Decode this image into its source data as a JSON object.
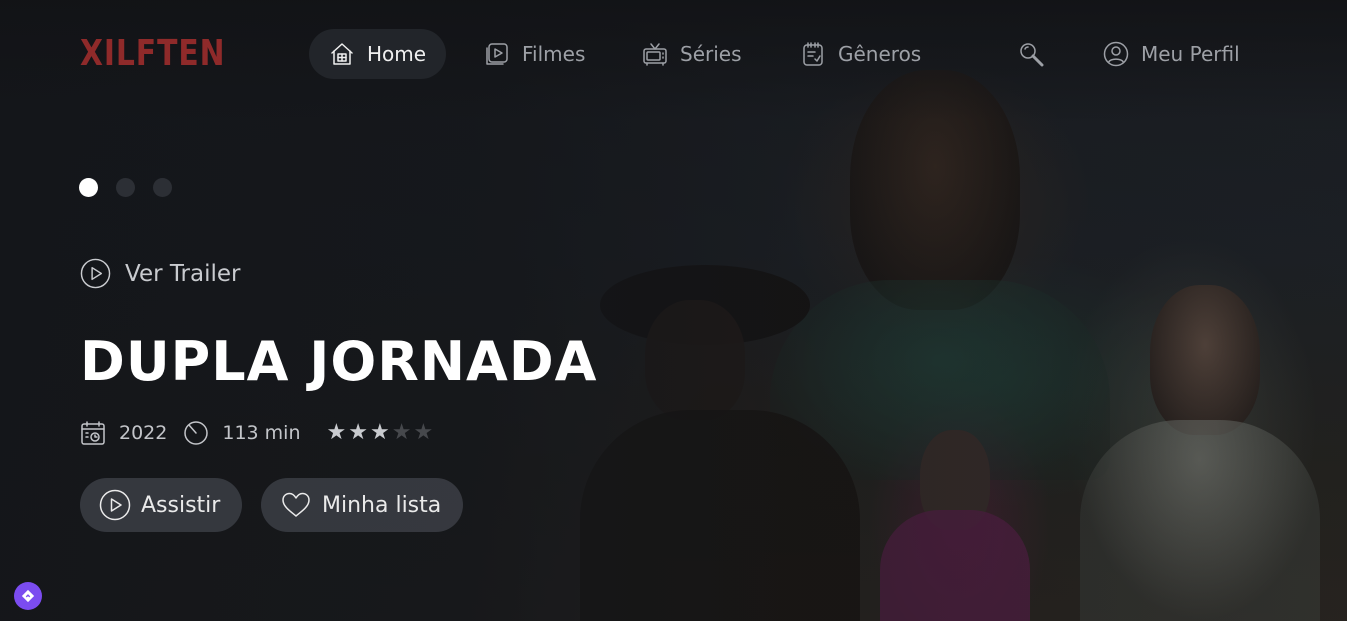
{
  "brand": {
    "logo": "XILFTEN",
    "logo_color": "#8f2a2a"
  },
  "nav": {
    "items": [
      {
        "label": "Home",
        "icon": "house-icon",
        "active": true
      },
      {
        "label": "Filmes",
        "icon": "film-icon"
      },
      {
        "label": "Séries",
        "icon": "tv-icon"
      },
      {
        "label": "Gêneros",
        "icon": "notepad-icon"
      }
    ],
    "search_icon": "search-icon",
    "profile": {
      "label": "Meu Perfil",
      "icon": "user-circle-icon"
    }
  },
  "slider": {
    "count": 3,
    "active_index": 0
  },
  "hero": {
    "trailer_label": "Ver Trailer",
    "title": "DUPLA JORNADA",
    "year": "2022",
    "duration": "113 min",
    "rating": 3,
    "rating_max": 5
  },
  "actions": {
    "watch_label": "Assistir",
    "list_label": "Minha lista"
  },
  "colors": {
    "background": "#15171b",
    "accent_fab": "#7b4cf0"
  }
}
